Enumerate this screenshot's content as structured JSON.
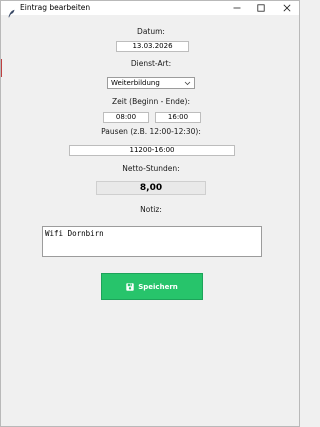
{
  "window": {
    "title": "Eintrag bearbeiten",
    "icon": "feather-icon"
  },
  "form": {
    "datum_label": "Datum:",
    "datum_value": "13.03.2026",
    "dienst_art_label": "Dienst-Art:",
    "dienst_art_value": "Weiterbildung",
    "zeit_label": "Zeit (Beginn - Ende):",
    "zeit_beginn": "08:00",
    "zeit_ende": "16:00",
    "pausen_label": "Pausen (z.B. 12:00-12:30):",
    "pausen_value": "11200-16:00",
    "netto_label": "Netto-Stunden:",
    "netto_value": "8,00",
    "notiz_label": "Notiz:",
    "notiz_value": "Wifi Dornbirn"
  },
  "actions": {
    "save_label": "Speichern",
    "save_icon": "floppy-disk-icon"
  },
  "colors": {
    "save_button_bg": "#27c46b",
    "window_bg": "#f0f0f0"
  }
}
